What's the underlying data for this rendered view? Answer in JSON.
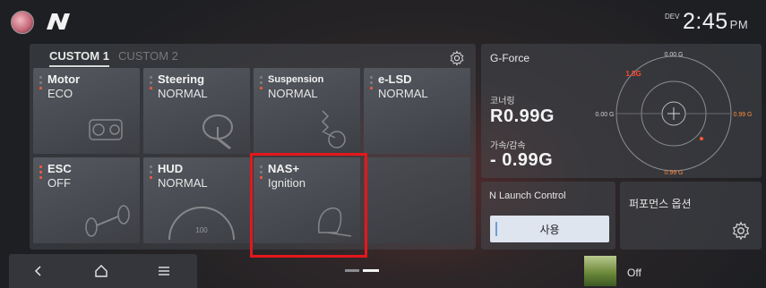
{
  "status_bar": {
    "signal": "DEV",
    "time": "2:45",
    "ampm": "PM"
  },
  "drive_panel": {
    "tabs": [
      {
        "label": "CUSTOM 1",
        "active": true
      },
      {
        "label": "CUSTOM 2",
        "active": false
      }
    ],
    "tiles": [
      {
        "name": "Motor",
        "value": "ECO"
      },
      {
        "name": "Steering",
        "value": "NORMAL"
      },
      {
        "name": "Suspension",
        "value": "NORMAL"
      },
      {
        "name": "e-LSD",
        "value": "NORMAL"
      },
      {
        "name": "ESC",
        "value": "OFF"
      },
      {
        "name": "HUD",
        "value": "NORMAL"
      },
      {
        "name": "NAS+",
        "value": "Ignition"
      }
    ],
    "hud_speed": "100"
  },
  "gforce": {
    "title": "G-Force",
    "cornering_label": "코너링",
    "cornering_value": "R0.99G",
    "accel_label": "가속/감속",
    "accel_value": "- 0.99G",
    "dial_top": "0.00 G",
    "dial_left": "0.00 G",
    "dial_right": "0.99 G",
    "dial_bottom": "0.99 G",
    "dial_peak": "1.5G",
    "accent_color": "#ff5a36"
  },
  "launch_control": {
    "title": "N Launch Control",
    "button_label": "사용"
  },
  "performance": {
    "title": "퍼포먼스 옵션"
  },
  "media": {
    "status": "Off"
  }
}
